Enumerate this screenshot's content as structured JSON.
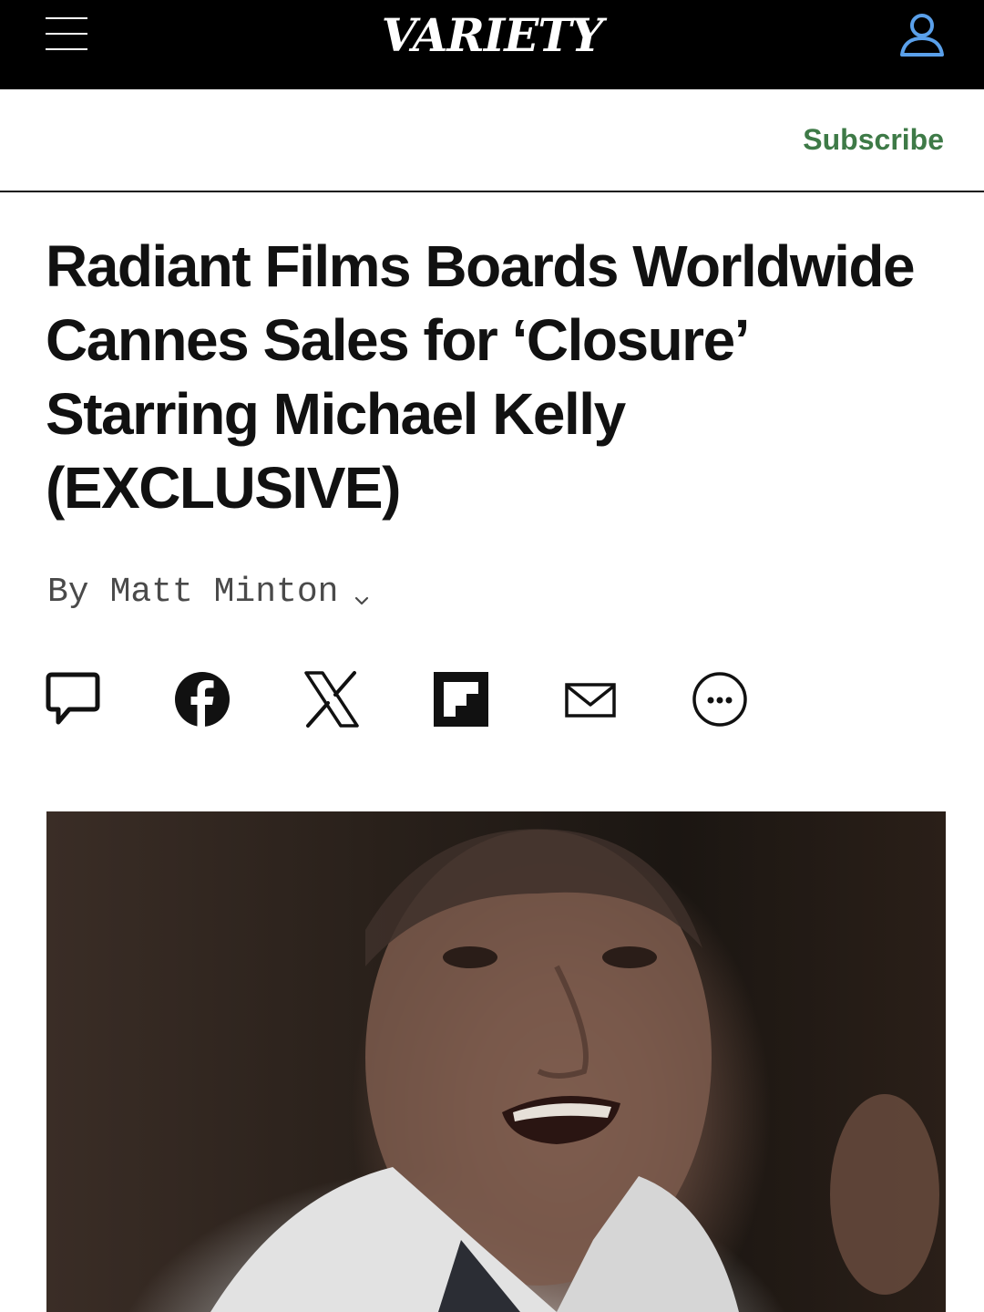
{
  "header": {
    "logo_text": "VARIETY",
    "menu_icon": "hamburger-icon",
    "account_icon": "user-icon",
    "background": "#000000"
  },
  "subheader": {
    "subscribe_label": "Subscribe",
    "subscribe_color": "#3e7a47"
  },
  "article": {
    "headline": "Radiant Films Boards Worldwide Cannes Sales for ‘Closure’ Starring Michael Kelly (EXCLUSIVE)",
    "byline_prefix": "By",
    "author": "Matt Minton",
    "share_icons": [
      "comment-icon",
      "facebook-icon",
      "x-icon",
      "flipboard-icon",
      "email-icon",
      "more-icon"
    ],
    "hero_image": "man-in-white-shirt-shouting-photo"
  }
}
